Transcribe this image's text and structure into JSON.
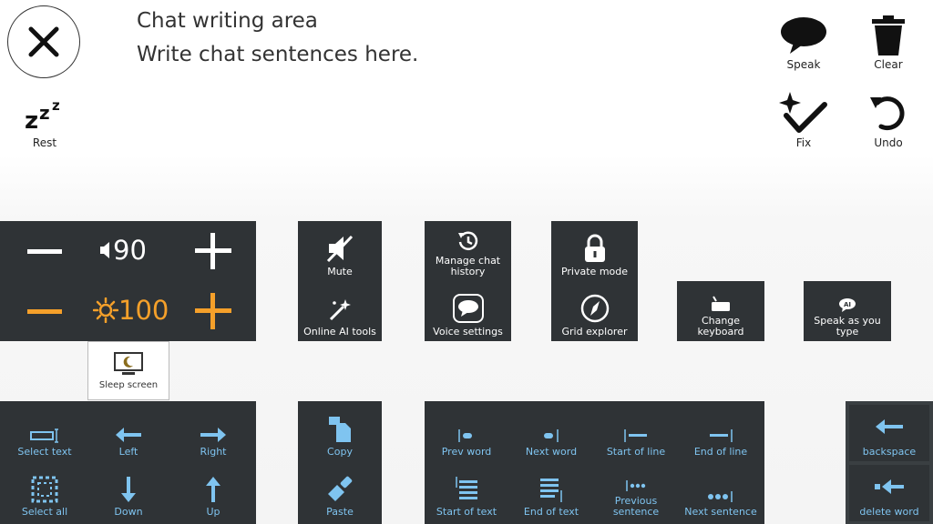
{
  "header": {
    "chat_title": "Chat writing area",
    "chat_placeholder": "Write chat sentences here."
  },
  "top_tools": {
    "rest": "Rest",
    "speak": "Speak",
    "clear": "Clear",
    "fix": "Fix",
    "undo": "Undo"
  },
  "volume_panel": {
    "volume_value": "90",
    "brightness_value": "100"
  },
  "menu1": {
    "mute": "Mute",
    "ai_tools": "Online AI tools"
  },
  "menu2": {
    "history": "Manage chat history",
    "voice": "Voice settings"
  },
  "menu3": {
    "private": "Private mode",
    "grid": "Grid explorer"
  },
  "menu4": {
    "keyboard": "Change keyboard",
    "speak_type": "Speak as you type"
  },
  "sleep": {
    "label": "Sleep screen"
  },
  "nav_panel": {
    "select_text": "Select text",
    "left": "Left",
    "right": "Right",
    "select_all": "Select all",
    "down": "Down",
    "up": "Up"
  },
  "clip_panel": {
    "copy": "Copy",
    "paste": "Paste"
  },
  "edit_panel": {
    "prev_word": "Prev word",
    "next_word": "Next word",
    "start_line": "Start of line",
    "end_line": "End of line",
    "start_text": "Start of text",
    "end_text": "End of text",
    "prev_sentence": "Previous sentence",
    "next_sentence": "Next sentence"
  },
  "delete_panel": {
    "backspace": "backspace",
    "delete_word": "delete word"
  },
  "colors": {
    "panel": "#2f3336",
    "accent_blue": "#7fc4f0",
    "accent_orange": "#f5a02a"
  }
}
